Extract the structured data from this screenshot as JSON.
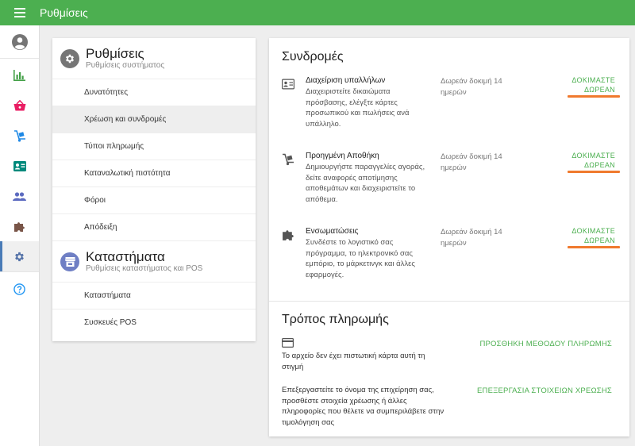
{
  "app": {
    "title": "Ρυθμίσεις"
  },
  "icons": {
    "menu": "menu-icon",
    "profile": "account-circle-icon",
    "reports": "bar-chart-icon",
    "shop": "basket-icon",
    "inventory": "hand-truck-icon",
    "employees": "id-card-icon",
    "customers": "people-icon",
    "integrations": "puzzle-icon",
    "settings": "gear-icon",
    "help": "help-circle-icon"
  },
  "colors": {
    "accent": "#4caf50",
    "highlight": "#f07a2e",
    "sidebar_active": "#4a7bb7"
  },
  "settings_panel": {
    "system": {
      "title": "Ρυθμίσεις",
      "subtitle": "Ρυθμίσεις συστήματος",
      "items": [
        "Δυνατότητες",
        "Χρέωση και συνδρομές",
        "Τύποι πληρωμής",
        "Καταναλωτική πιστότητα",
        "Φόροι",
        "Απόδειξη"
      ]
    },
    "stores": {
      "title": "Καταστήματα",
      "subtitle": "Ρυθμίσεις καταστήματος και POS",
      "items": [
        "Καταστήματα",
        "Συσκευές POS"
      ]
    }
  },
  "subscriptions": {
    "title": "Συνδρομές",
    "rows": [
      {
        "name": "Διαχείριση υπαλλήλων",
        "description": "Διαχειριστείτε δικαιώματα πρόσβασης, ελέγξτε κάρτες προσωπικού και πωλήσεις ανά υπάλληλο.",
        "trial": "Δωρεάν δοκιμή 14 ημερών",
        "action": "ΔΟΚΙΜΑΣΤΕ ΔΩΡΕΑΝ"
      },
      {
        "name": "Προηγμένη Αποθήκη",
        "description": "Δημιουργήστε παραγγελίες αγοράς, δείτε αναφορές αποτίμησης αποθεμάτων και διαχειριστείτε το απόθεμα.",
        "trial": "Δωρεάν δοκιμή 14 ημερών",
        "action": "ΔΟΚΙΜΑΣΤΕ ΔΩΡΕΑΝ"
      },
      {
        "name": "Ενσωματώσεις",
        "description": "Συνδέστε το λογιστικό σας πρόγραμμα, το ηλεκτρονικό σας εμπόριο, το μάρκετινγκ και άλλες εφαρμογές.",
        "trial": "Δωρεάν δοκιμή 14 ημερών",
        "action": "ΔΟΚΙΜΑΣΤΕ ΔΩΡΕΑΝ"
      }
    ]
  },
  "payment": {
    "title": "Τρόπος πληρωμής",
    "no_card": "Το αρχείο δεν έχει πιστωτική κάρτα αυτή τη στιγμή",
    "add_method": "ΠΡΟΣΘΗΚΗ ΜΕΘΟΔΟΥ ΠΛΗΡΩΜΗΣ",
    "edit_hint": "Επεξεργαστείτε το όνομα της επιχείρηση σας, προσθέστε στοιχεία χρέωσης ή άλλες πληροφορίες που θέλετε να συμπεριλάβετε στην τιμολόγηση σας",
    "edit_billing": "ΕΠΕΞΕΡΓΑΣΙΑ ΣΤΟΙΧΕΙΩΝ ΧΡΕΩΣΗΣ"
  }
}
